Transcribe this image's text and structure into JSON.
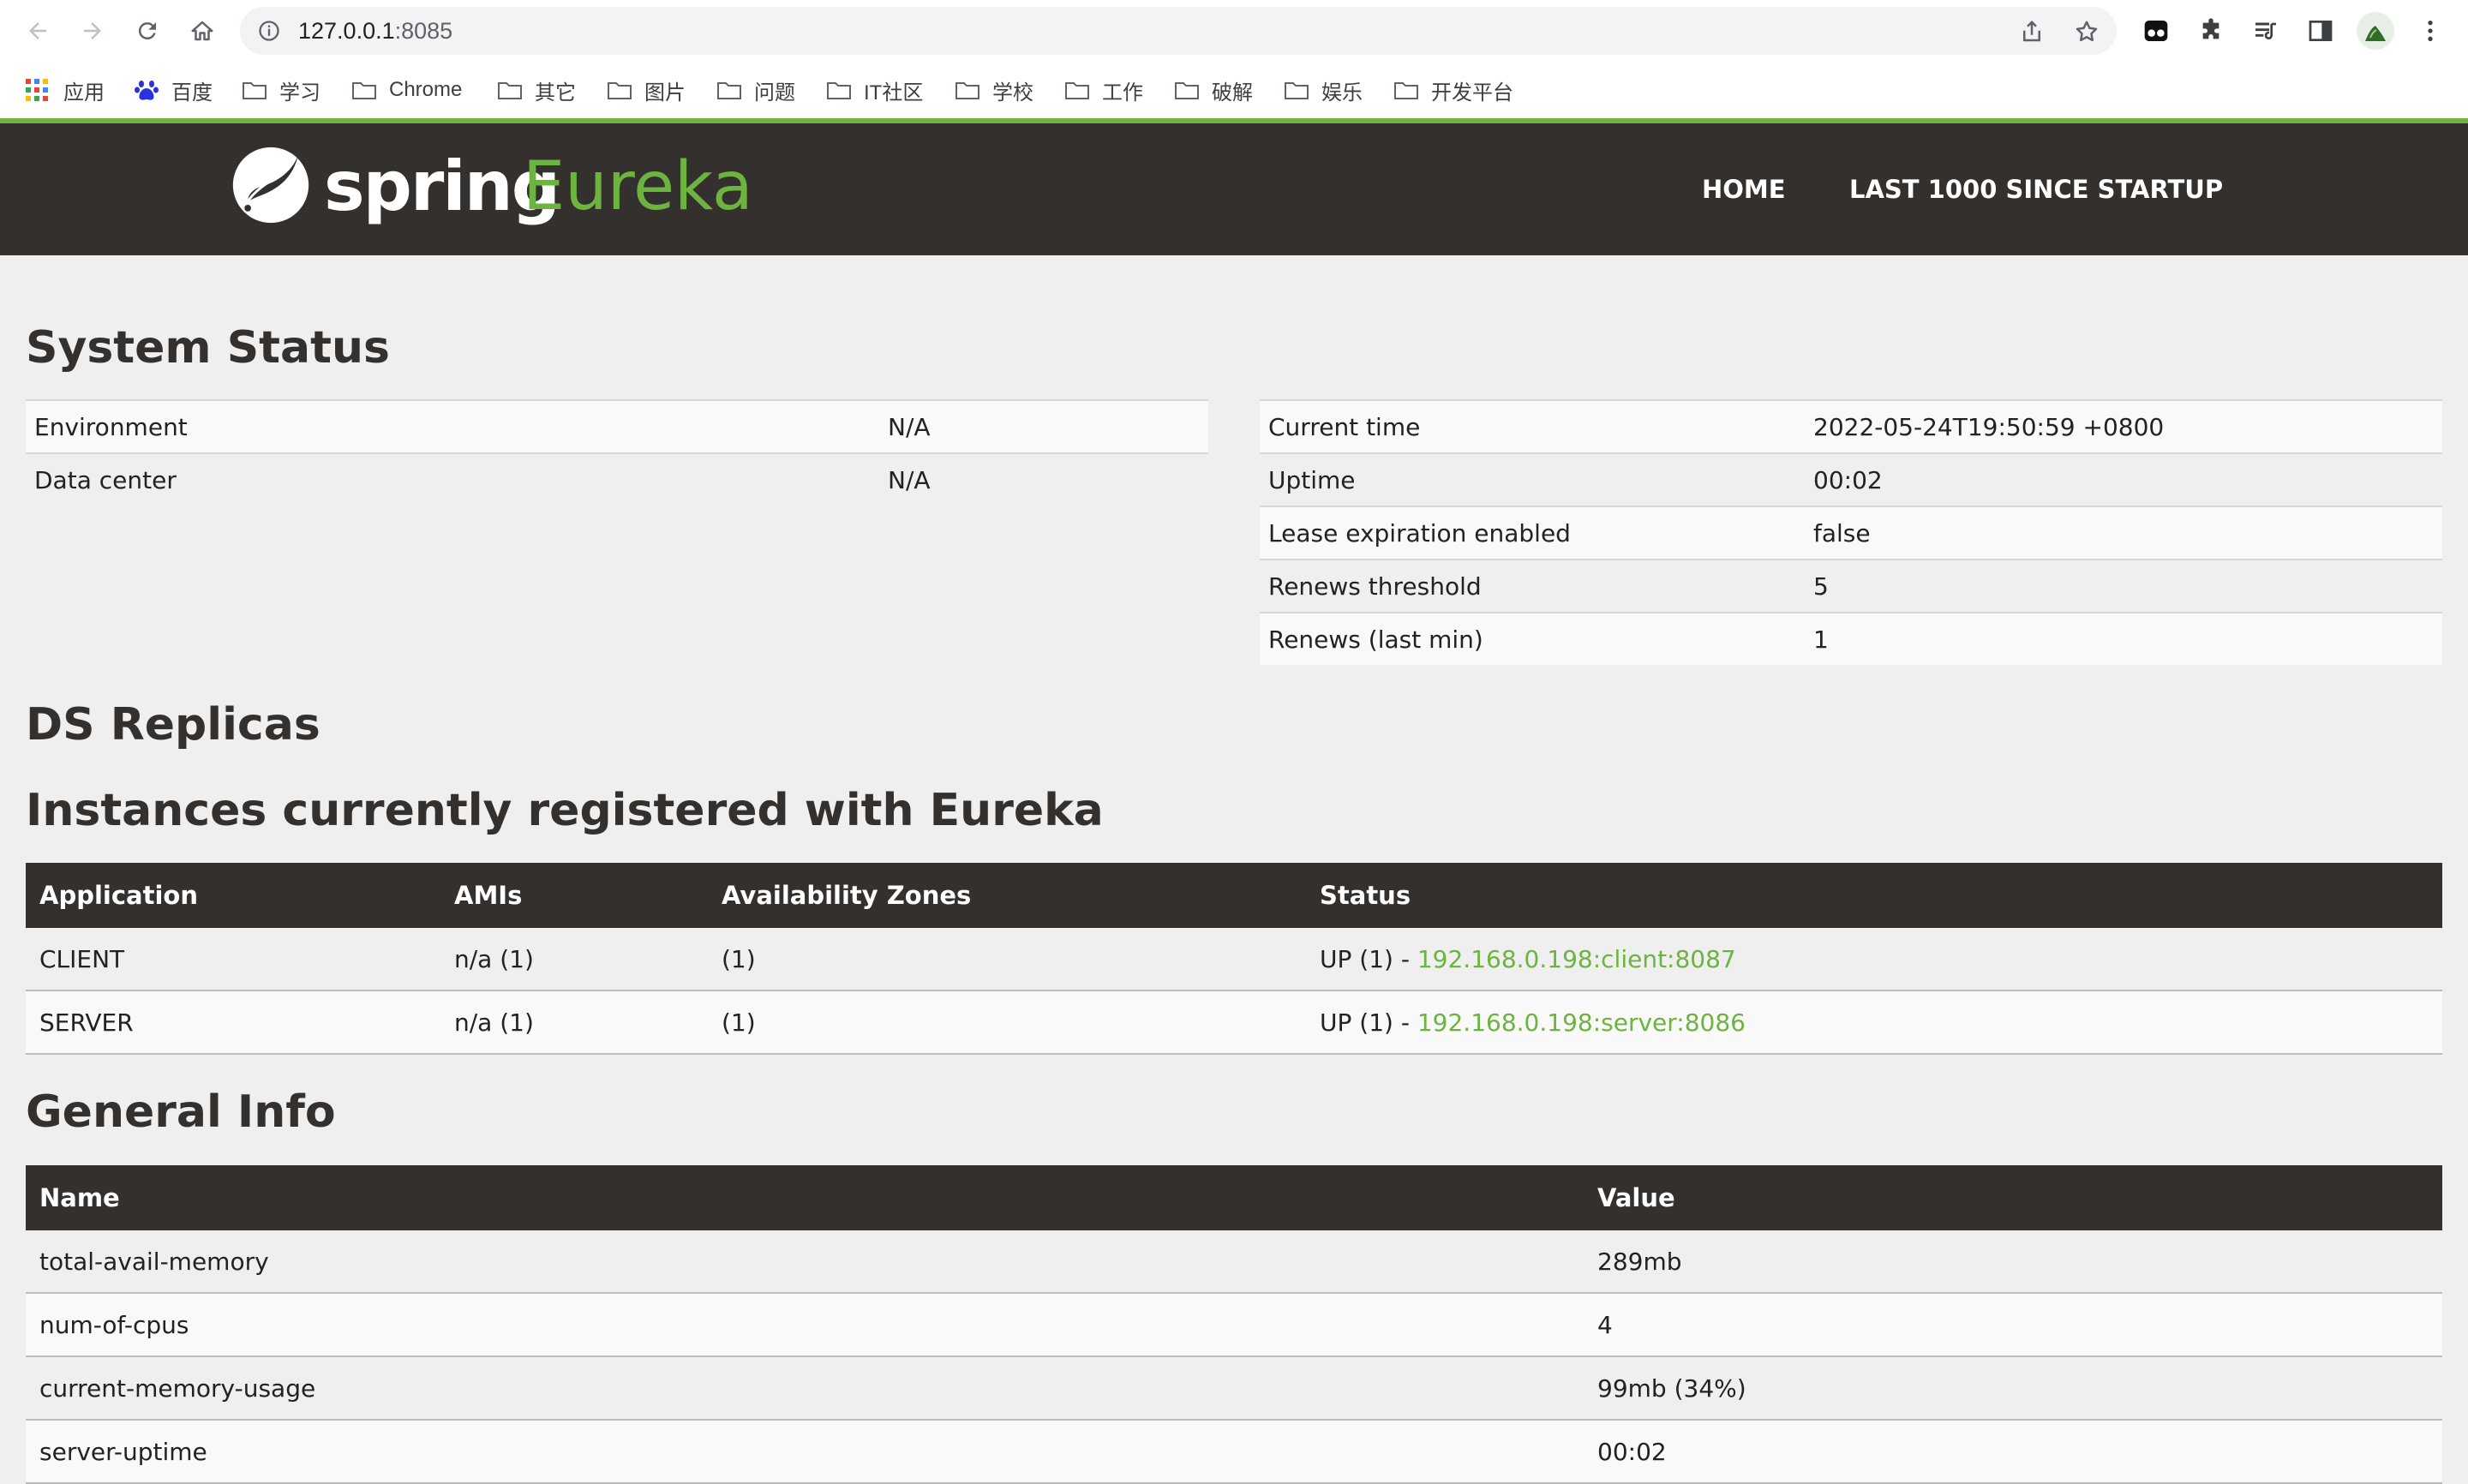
{
  "browser": {
    "url_host": "127.0.0.1",
    "url_port": ":8085",
    "bookmarks": [
      "应用",
      "百度",
      "学习",
      "Chrome",
      "其它",
      "图片",
      "问题",
      "IT社区",
      "学校",
      "工作",
      "破解",
      "娱乐",
      "开发平台"
    ]
  },
  "header": {
    "logo_spring": "spring",
    "logo_eureka": "Eureka",
    "nav": [
      "HOME",
      "LAST 1000 SINCE STARTUP"
    ]
  },
  "system_status": {
    "title": "System Status",
    "left": [
      {
        "label": "Environment",
        "value": "N/A"
      },
      {
        "label": "Data center",
        "value": "N/A"
      }
    ],
    "right": [
      {
        "label": "Current time",
        "value": "2022-05-24T19:50:59 +0800"
      },
      {
        "label": "Uptime",
        "value": "00:02"
      },
      {
        "label": "Lease expiration enabled",
        "value": "false"
      },
      {
        "label": "Renews threshold",
        "value": "5"
      },
      {
        "label": "Renews (last min)",
        "value": "1"
      }
    ]
  },
  "ds_replicas": {
    "title": "DS Replicas"
  },
  "instances": {
    "title": "Instances currently registered with Eureka",
    "columns": [
      "Application",
      "AMIs",
      "Availability Zones",
      "Status"
    ],
    "rows": [
      {
        "application": "CLIENT",
        "amis": "n/a (1)",
        "zones": "(1)",
        "status_prefix": "UP (1) - ",
        "link": "192.168.0.198:client:8087"
      },
      {
        "application": "SERVER",
        "amis": "n/a (1)",
        "zones": "(1)",
        "status_prefix": "UP (1) - ",
        "link": "192.168.0.198:server:8086"
      }
    ]
  },
  "general_info": {
    "title": "General Info",
    "columns": [
      "Name",
      "Value"
    ],
    "rows": [
      {
        "name": "total-avail-memory",
        "value": "289mb"
      },
      {
        "name": "num-of-cpus",
        "value": "4"
      },
      {
        "name": "current-memory-usage",
        "value": "99mb (34%)"
      },
      {
        "name": "server-uptime",
        "value": "00:02"
      }
    ]
  },
  "colors": {
    "brand_green": "#6db33f",
    "navbar": "#34302d",
    "page_bg": "#efefef"
  }
}
